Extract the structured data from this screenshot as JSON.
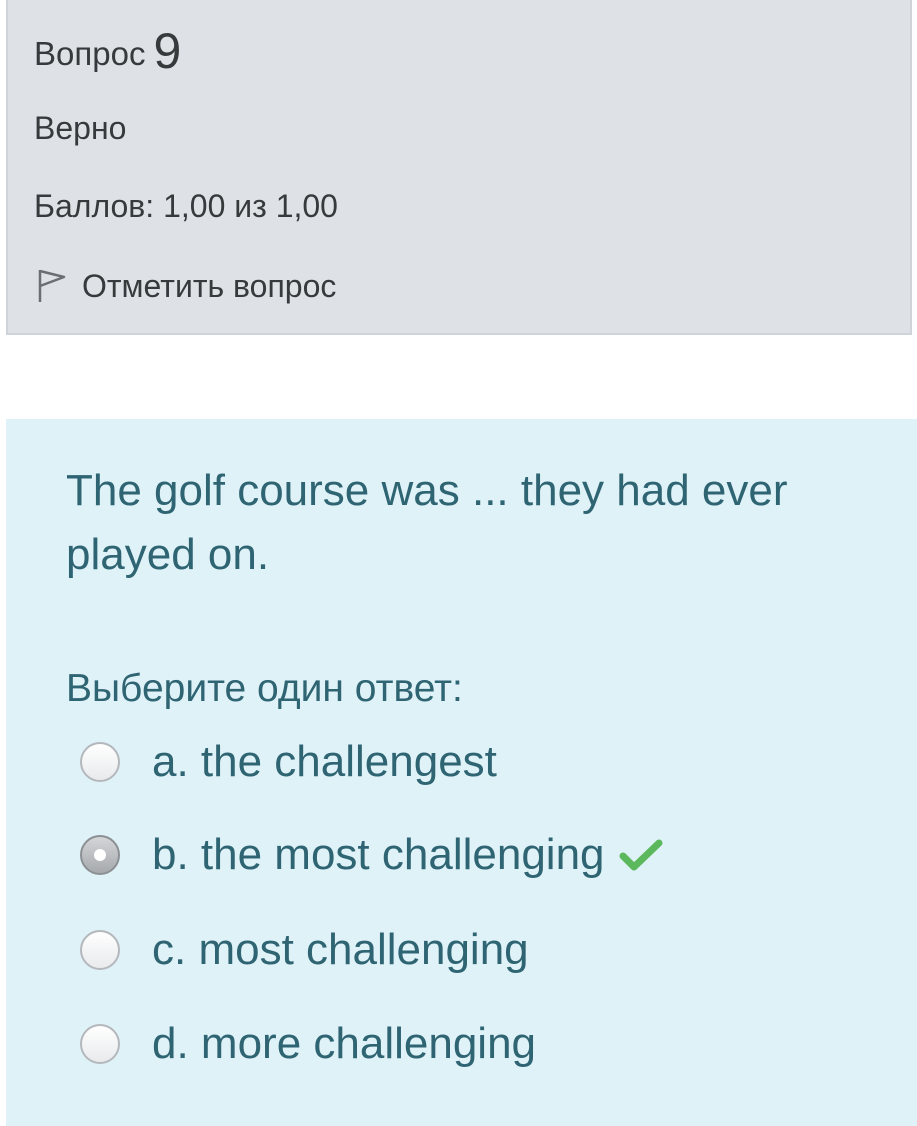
{
  "info": {
    "question_label": "Вопрос",
    "question_number": "9",
    "state": "Верно",
    "grade": "Баллов: 1,00 из 1,00",
    "flag_label": "Отметить вопрос",
    "flag_icon": "flag-icon"
  },
  "question": {
    "text": "The golf course was ... they had ever played on.",
    "prompt": "Выберите один ответ:",
    "answers": [
      {
        "label": "a. the challengest",
        "selected": false
      },
      {
        "label": "b. the most challenging",
        "selected": true,
        "correct": true
      },
      {
        "label": "c. most challenging",
        "selected": false
      },
      {
        "label": "d. more challenging",
        "selected": false
      }
    ],
    "correct_icon": "check-icon",
    "correct_color": "#5cb85c"
  },
  "colors": {
    "info_bg": "#dee2e6",
    "formulation_bg": "#def2f8",
    "formulation_text": "#2f6473"
  }
}
